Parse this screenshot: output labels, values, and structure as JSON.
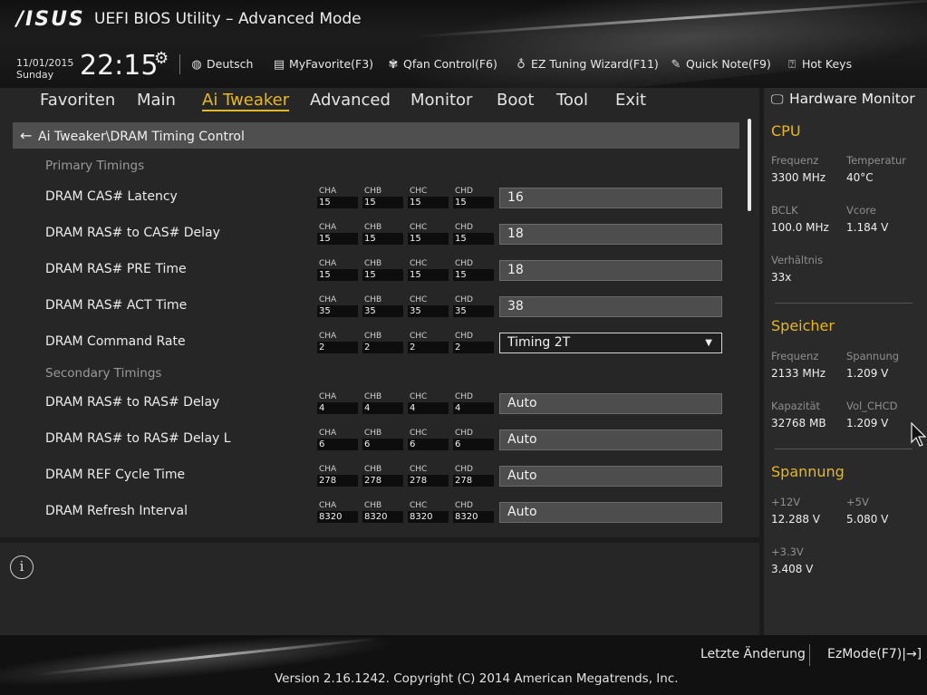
{
  "header": {
    "logo": "/ISUS",
    "title": "UEFI BIOS Utility – Advanced Mode",
    "date": "11/01/2015",
    "day": "Sunday",
    "time": "22:15",
    "toolbar": [
      {
        "label": "Deutsch",
        "icon": "globe-icon"
      },
      {
        "label": "MyFavorite(F3)",
        "icon": "favorite-icon"
      },
      {
        "label": "Qfan Control(F6)",
        "icon": "fan-icon"
      },
      {
        "label": "EZ Tuning Wizard(F11)",
        "icon": "bulb-icon"
      },
      {
        "label": "Quick Note(F9)",
        "icon": "note-icon"
      },
      {
        "label": "Hot Keys",
        "icon": "hotkeys-icon"
      }
    ]
  },
  "nav": {
    "tabs": [
      "Favoriten",
      "Main",
      "Ai Tweaker",
      "Advanced",
      "Monitor",
      "Boot",
      "Tool",
      "Exit"
    ],
    "active": "Ai Tweaker"
  },
  "main": {
    "breadcrumb": "Ai Tweaker\\DRAM Timing Control",
    "channels": [
      "CHA",
      "CHB",
      "CHC",
      "CHD"
    ],
    "sections": {
      "primary": "Primary Timings",
      "secondary": "Secondary Timings"
    },
    "rows": [
      {
        "label": "DRAM CAS# Latency",
        "ch": [
          "15",
          "15",
          "15",
          "15"
        ],
        "value": "16"
      },
      {
        "label": "DRAM RAS# to CAS# Delay",
        "ch": [
          "15",
          "15",
          "15",
          "15"
        ],
        "value": "18"
      },
      {
        "label": "DRAM RAS# PRE Time",
        "ch": [
          "15",
          "15",
          "15",
          "15"
        ],
        "value": "18"
      },
      {
        "label": "DRAM RAS# ACT Time",
        "ch": [
          "35",
          "35",
          "35",
          "35"
        ],
        "value": "38"
      },
      {
        "label": "DRAM Command Rate",
        "ch": [
          "2",
          "2",
          "2",
          "2"
        ],
        "value": "Timing 2T"
      },
      {
        "label": "DRAM RAS# to RAS# Delay",
        "ch": [
          "4",
          "4",
          "4",
          "4"
        ],
        "value": "Auto"
      },
      {
        "label": "DRAM RAS# to RAS# Delay L",
        "ch": [
          "6",
          "6",
          "6",
          "6"
        ],
        "value": "Auto"
      },
      {
        "label": "DRAM REF Cycle Time",
        "ch": [
          "278",
          "278",
          "278",
          "278"
        ],
        "value": "Auto"
      },
      {
        "label": "DRAM Refresh Interval",
        "ch": [
          "8320",
          "8320",
          "8320",
          "8320"
        ],
        "value": "Auto"
      }
    ]
  },
  "hw": {
    "title": "Hardware Monitor",
    "cpu": {
      "heading": "CPU",
      "freq_label": "Frequenz",
      "freq": "3300 MHz",
      "temp_label": "Temperatur",
      "temp": "40°C",
      "bclk_label": "BCLK",
      "bclk": "100.0 MHz",
      "vcore_label": "Vcore",
      "vcore": "1.184 V",
      "ratio_label": "Verhältnis",
      "ratio": "33x"
    },
    "mem": {
      "heading": "Speicher",
      "freq_label": "Frequenz",
      "freq": "2133 MHz",
      "volt_label": "Spannung",
      "volt": "1.209 V",
      "cap_label": "Kapazität",
      "cap": "32768 MB",
      "vol_label": "Vol_CHCD",
      "vol": "1.209 V"
    },
    "volt": {
      "heading": "Spannung",
      "v12_label": "+12V",
      "v12": "12.288 V",
      "v5_label": "+5V",
      "v5": "5.080 V",
      "v33_label": "+3.3V",
      "v33": "3.408 V"
    }
  },
  "footer": {
    "last_change": "Letzte Änderung",
    "ezmode": "EzMode(F7)|",
    "copyright": "Version 2.16.1242. Copyright (C) 2014 American Megatrends, Inc."
  }
}
